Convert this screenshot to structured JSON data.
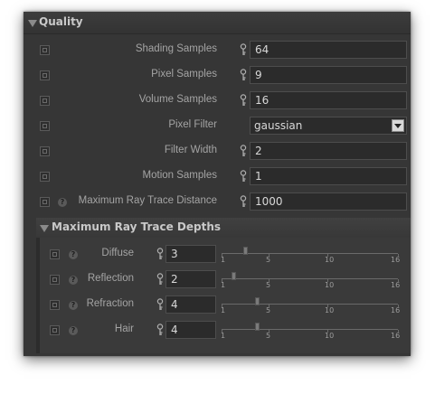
{
  "quality": {
    "title": "Quality",
    "rows": [
      {
        "label": "Shading Samples",
        "value": "64"
      },
      {
        "label": "Pixel Samples",
        "value": "9"
      },
      {
        "label": "Volume Samples",
        "value": "16"
      },
      {
        "label": "Pixel Filter",
        "value": "gaussian"
      },
      {
        "label": "Filter Width",
        "value": "2"
      },
      {
        "label": "Motion Samples",
        "value": "1"
      },
      {
        "label": "Maximum Ray Trace Distance",
        "value": "1000"
      }
    ],
    "help_glyph": "?"
  },
  "depths": {
    "title": "Maximum Ray Trace Depths",
    "ticks": [
      "1",
      "5",
      "10",
      "16"
    ],
    "rows": [
      {
        "label": "Diffuse",
        "value": "3",
        "slider_value": 3
      },
      {
        "label": "Reflection",
        "value": "2",
        "slider_value": 2
      },
      {
        "label": "Refraction",
        "value": "4",
        "slider_value": 4
      },
      {
        "label": "Hair",
        "value": "4",
        "slider_value": 4
      }
    ]
  }
}
